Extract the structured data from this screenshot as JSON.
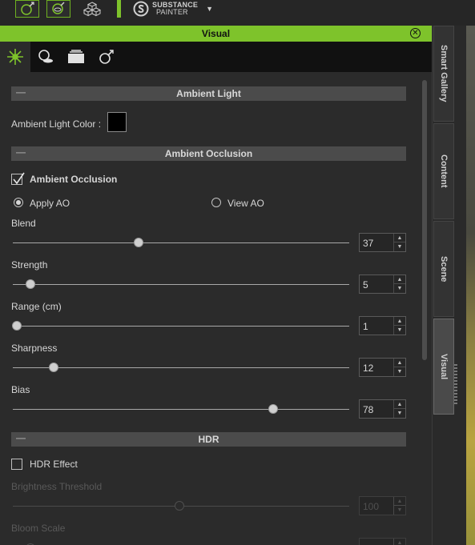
{
  "toolbar": {
    "buttons": [
      {
        "icon": "sphere-light-icon"
      },
      {
        "icon": "sphere-eye-icon"
      },
      {
        "icon": "cubes-icon"
      }
    ],
    "substance_line1": "SUBSTANCE",
    "substance_line2": "PAINTER",
    "substance_caret": "▼"
  },
  "panel": {
    "title": "Visual",
    "close_icon": "close-icon",
    "tabs": [
      {
        "icon": "light-burst-icon",
        "active": true
      },
      {
        "icon": "shadow-icon",
        "active": false
      },
      {
        "icon": "layers-icon",
        "active": false
      },
      {
        "icon": "sphere-arrow-icon",
        "active": false
      }
    ]
  },
  "side_tabs": [
    "Smart Gallery",
    "Content",
    "Scene",
    "Visual"
  ],
  "ambient_light": {
    "header": "Ambient Light",
    "color_label": "Ambient Light Color :",
    "color": "#000000"
  },
  "ambient_occlusion": {
    "header": "Ambient Occlusion",
    "checkbox_label": "Ambient Occlusion",
    "checked": true,
    "radio_apply": "Apply AO",
    "radio_view": "View AO",
    "selected": "Apply AO",
    "sliders": [
      {
        "label": "Blend",
        "value": "37",
        "level": 0.37
      },
      {
        "label": "Strength",
        "value": "5",
        "level": 0.05
      },
      {
        "label": "Range (cm)",
        "value": "1",
        "level": 0.0
      },
      {
        "label": "Sharpness",
        "value": "12",
        "level": 0.12
      },
      {
        "label": "Bias",
        "value": "78",
        "level": 0.78
      }
    ]
  },
  "hdr": {
    "header": "HDR",
    "checkbox_label": "HDR Effect",
    "checked": false,
    "sliders": [
      {
        "label": "Brightness Threshold",
        "value": "100",
        "level": 0.5
      },
      {
        "label": "Bloom Scale",
        "value": "",
        "level": 0.05
      }
    ]
  },
  "colors": {
    "accent": "#7ec32b",
    "panel_bg": "#2b2b2b",
    "section_bar": "#4b4b4b"
  }
}
